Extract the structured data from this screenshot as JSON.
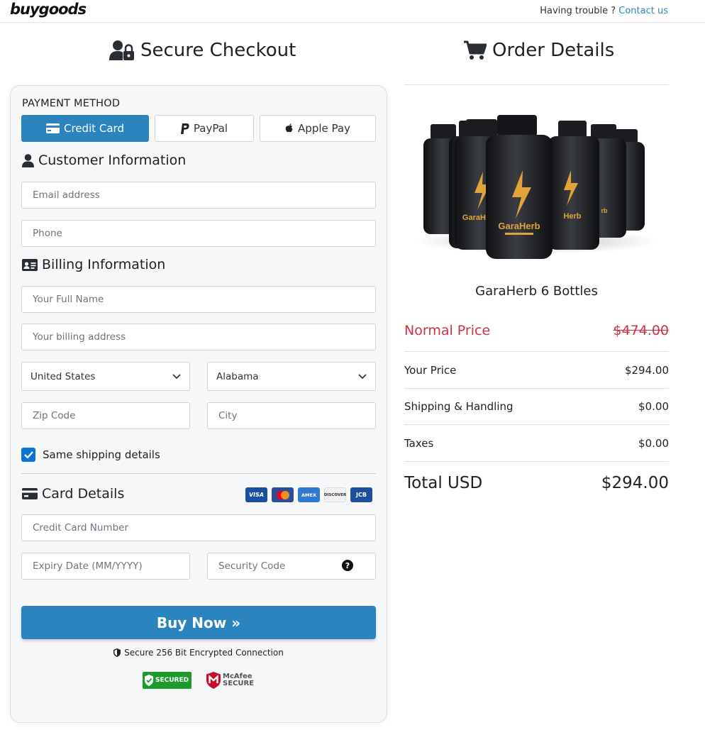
{
  "header": {
    "logo": "buygoods",
    "trouble_text": "Having trouble ?",
    "contact_link": "Contact us"
  },
  "checkout": {
    "title": "Secure Checkout",
    "payment_method_label": "PAYMENT METHOD",
    "payment_methods": [
      "Credit Card",
      "PayPal",
      "Apple Pay"
    ],
    "selected_payment_method": "Credit Card",
    "customer_info_title": "Customer Information",
    "email_placeholder": "Email address",
    "phone_placeholder": "Phone",
    "billing_info_title": "Billing Information",
    "full_name_placeholder": "Your Full Name",
    "billing_address_placeholder": "Your billing address",
    "country": "United States",
    "state": "Alabama",
    "zip_placeholder": "Zip Code",
    "city_placeholder": "City",
    "same_shipping_label": "Same shipping details",
    "same_shipping_checked": true,
    "card_details_title": "Card Details",
    "card_brands": [
      "VISA",
      "MC",
      "AMEX",
      "DISCOVER",
      "JCB"
    ],
    "card_number_placeholder": "Credit Card Number",
    "expiry_placeholder": "Expiry Date (MM/YYYY)",
    "security_code_placeholder": "Security Code",
    "buy_button": "Buy Now »",
    "secure_text": "Secure 256 Bit Encrypted Connection",
    "badges": {
      "trustguard": "SECURED",
      "mcafee_line1": "McAfee",
      "mcafee_line2": "SECURE"
    }
  },
  "order": {
    "title": "Order Details",
    "product_name": "GaraHerb 6 Bottles",
    "bottle_label": "GaraHerb",
    "rows": [
      {
        "label": "Normal Price",
        "value": "$474.00"
      },
      {
        "label": "Your Price",
        "value": "$294.00"
      },
      {
        "label": "Shipping & Handling",
        "value": "$0.00"
      },
      {
        "label": "Taxes",
        "value": "$0.00"
      }
    ],
    "total_label": "Total USD",
    "total_value": "$294.00"
  },
  "colors": {
    "primary": "#2b84bd",
    "strike_red": "#cc3340",
    "checkbox": "#0b72d6"
  }
}
